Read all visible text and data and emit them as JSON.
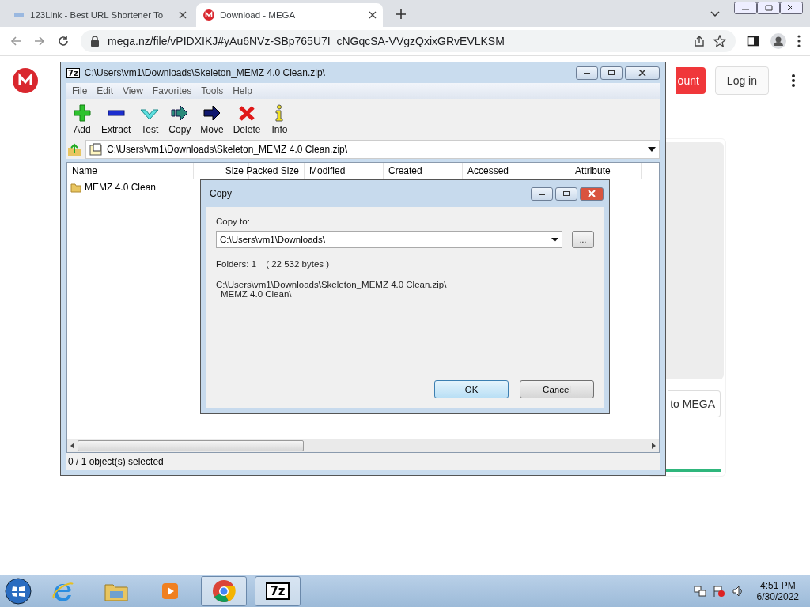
{
  "browser": {
    "tabs": [
      {
        "title": "123Link - Best URL Shortener To",
        "selected": false,
        "kind": "link"
      },
      {
        "title": "Download - MEGA",
        "selected": true,
        "kind": "mega"
      }
    ],
    "url": "mega.nz/file/vPIDXIKJ#yAu6NVz-SBp765U7I_cNGqcSA-VVgzQxixGRvEVLKSM"
  },
  "page": {
    "header_buttons": [
      {
        "label": "ount",
        "kind": "primary"
      },
      {
        "label": "Log in",
        "kind": "secondary"
      }
    ],
    "card_button": "to MEGA"
  },
  "archive_window": {
    "logo": "7z",
    "title": "C:\\Users\\vm1\\Downloads\\Skeleton_MEMZ 4.0 Clean.zip\\",
    "menu": [
      "File",
      "Edit",
      "View",
      "Favorites",
      "Tools",
      "Help"
    ],
    "toolbar": [
      {
        "label": "Add",
        "kind": "add"
      },
      {
        "label": "Extract",
        "kind": "extract"
      },
      {
        "label": "Test",
        "kind": "test"
      },
      {
        "label": "Copy",
        "kind": "copy"
      },
      {
        "label": "Move",
        "kind": "move"
      },
      {
        "label": "Delete",
        "kind": "delete"
      },
      {
        "label": "Info",
        "kind": "info"
      }
    ],
    "path": "C:\\Users\\vm1\\Downloads\\Skeleton_MEMZ 4.0 Clean.zip\\",
    "columns": [
      "Name",
      "Size",
      "Packed Size",
      "Modified",
      "Created",
      "Accessed",
      "Attribute"
    ],
    "rows": [
      {
        "name": "MEMZ 4.0 Clean",
        "selected": false
      }
    ],
    "status": "0 / 1 object(s) selected"
  },
  "copy_dialog": {
    "title": "Copy",
    "label": "Copy to:",
    "value": "C:\\Users\\vm1\\Downloads\\",
    "browse": "...",
    "folders": "Folders: 1",
    "bytes": "( 22 532 bytes )",
    "paths": [
      "C:\\Users\\vm1\\Downloads\\Skeleton_MEMZ 4.0 Clean.zip\\",
      "MEMZ 4.0 Clean\\"
    ],
    "buttons": [
      {
        "label": "OK",
        "default": true
      },
      {
        "label": "Cancel",
        "default": false
      }
    ]
  },
  "taskbar": {
    "apps": [
      {
        "kind": "ie",
        "selected": false
      },
      {
        "kind": "explorer",
        "selected": false
      },
      {
        "kind": "media",
        "selected": false
      },
      {
        "kind": "chrome",
        "selected": true
      },
      {
        "kind": "sevenzip",
        "selected": true,
        "logo": "7z"
      }
    ],
    "time": "4:51 PM",
    "date": "6/30/2022"
  }
}
